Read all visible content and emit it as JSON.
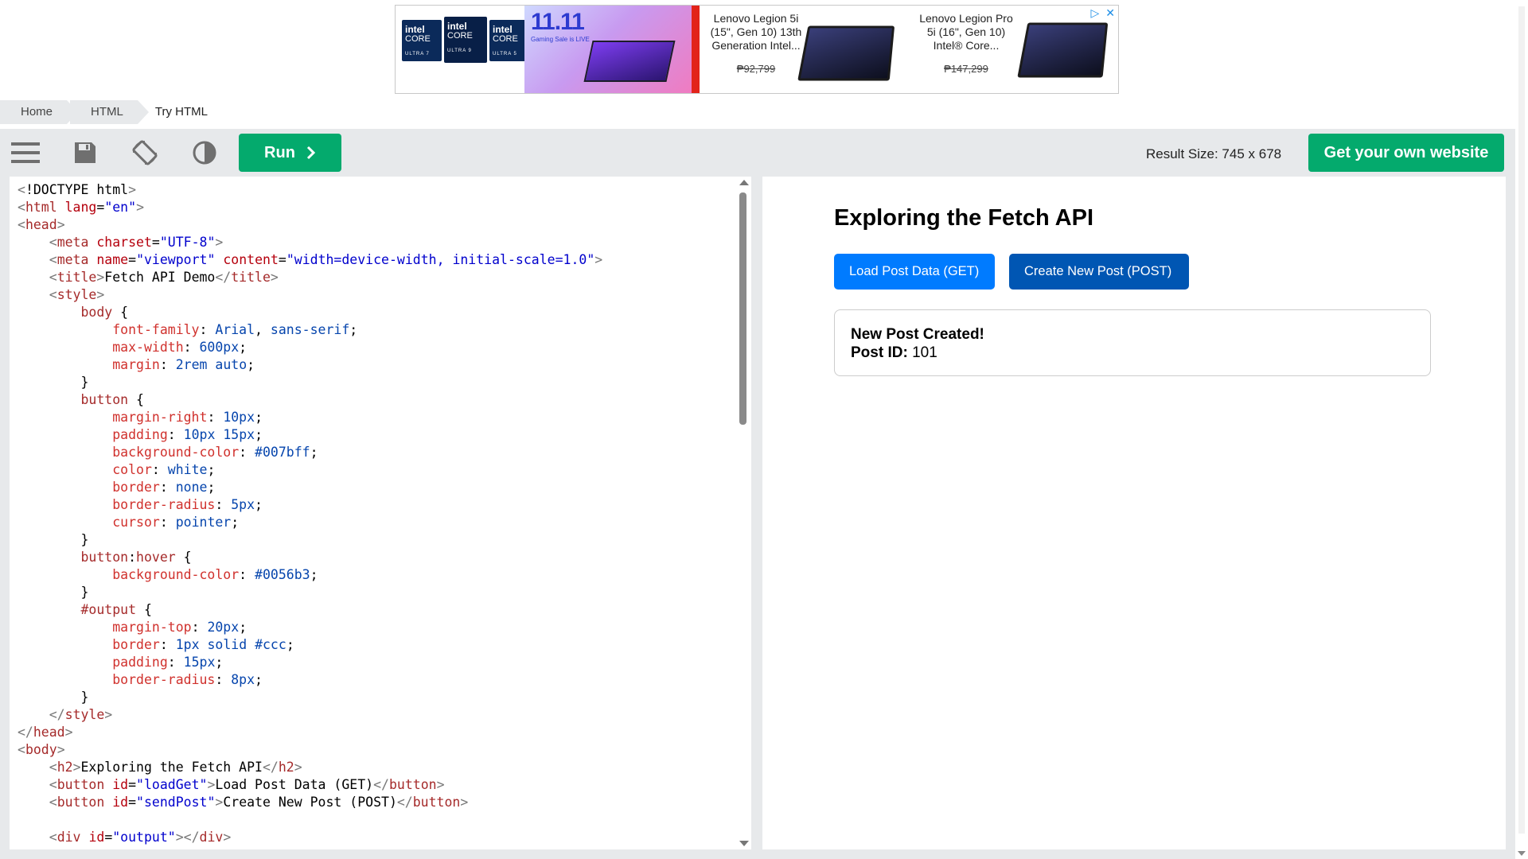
{
  "ad": {
    "intel_chips": [
      {
        "brand": "intel",
        "line": "CORE",
        "tier": "ULTRA 7"
      },
      {
        "brand": "intel",
        "line": "CORE",
        "tier": "ULTRA 9"
      },
      {
        "brand": "intel",
        "line": "CORE",
        "tier": "ULTRA 5"
      }
    ],
    "promo_big": "11.11",
    "promo_small": "Gaming Sale is LIVE",
    "products": [
      {
        "title": "Lenovo Legion 5i (15\", Gen 10) 13th Generation Intel...",
        "price": "₱92,799"
      },
      {
        "title": "Lenovo Legion Pro 5i (16\", Gen 10) Intel® Core...",
        "price": "₱147,299"
      }
    ],
    "adchoices_icon": "adchoices-icon",
    "close_icon": "close-icon"
  },
  "breadcrumb": {
    "items": [
      "Home",
      "HTML",
      "Try HTML"
    ]
  },
  "toolbar": {
    "menu_icon": "hamburger-menu-icon",
    "save_icon": "save-icon",
    "rotate_icon": "rotate-icon",
    "theme_icon": "contrast-icon",
    "run_label": "Run",
    "result_size": "Result Size: 745 x 678",
    "get_website_label": "Get your own website"
  },
  "editor": {
    "lines": [
      "<!DOCTYPE html>",
      "<html lang=\"en\">",
      "<head>",
      "    <meta charset=\"UTF-8\">",
      "    <meta name=\"viewport\" content=\"width=device-width, initial-scale=1.0\">",
      "    <title>Fetch API Demo</title>",
      "    <style>",
      "        body {",
      "            font-family: Arial, sans-serif;",
      "            max-width: 600px;",
      "            margin: 2rem auto;",
      "        }",
      "        button {",
      "            margin-right: 10px;",
      "            padding: 10px 15px;",
      "            background-color: #007bff;",
      "            color: white;",
      "            border: none;",
      "            border-radius: 5px;",
      "            cursor: pointer;",
      "        }",
      "        button:hover {",
      "            background-color: #0056b3;",
      "        }",
      "        #output {",
      "            margin-top: 20px;",
      "            border: 1px solid #ccc;",
      "            padding: 15px;",
      "            border-radius: 8px;",
      "        }",
      "    </style>",
      "</head>",
      "<body>",
      "    <h2>Exploring the Fetch API</h2>",
      "    <button id=\"loadGet\">Load Post Data (GET)</button>",
      "    <button id=\"sendPost\">Create New Post (POST)</button>",
      "",
      "    <div id=\"output\"></div>"
    ]
  },
  "result": {
    "heading": "Exploring the Fetch API",
    "button_get": "Load Post Data (GET)",
    "button_post": "Create New Post (POST)",
    "output_title": "New Post Created!",
    "output_id_label": "Post ID:",
    "output_id_value": "101"
  },
  "colors": {
    "brand_green": "#04aa6d",
    "button_blue": "#007bff",
    "button_hover_blue": "#0056b3",
    "toolbar_gray": "#e7e9eb"
  }
}
